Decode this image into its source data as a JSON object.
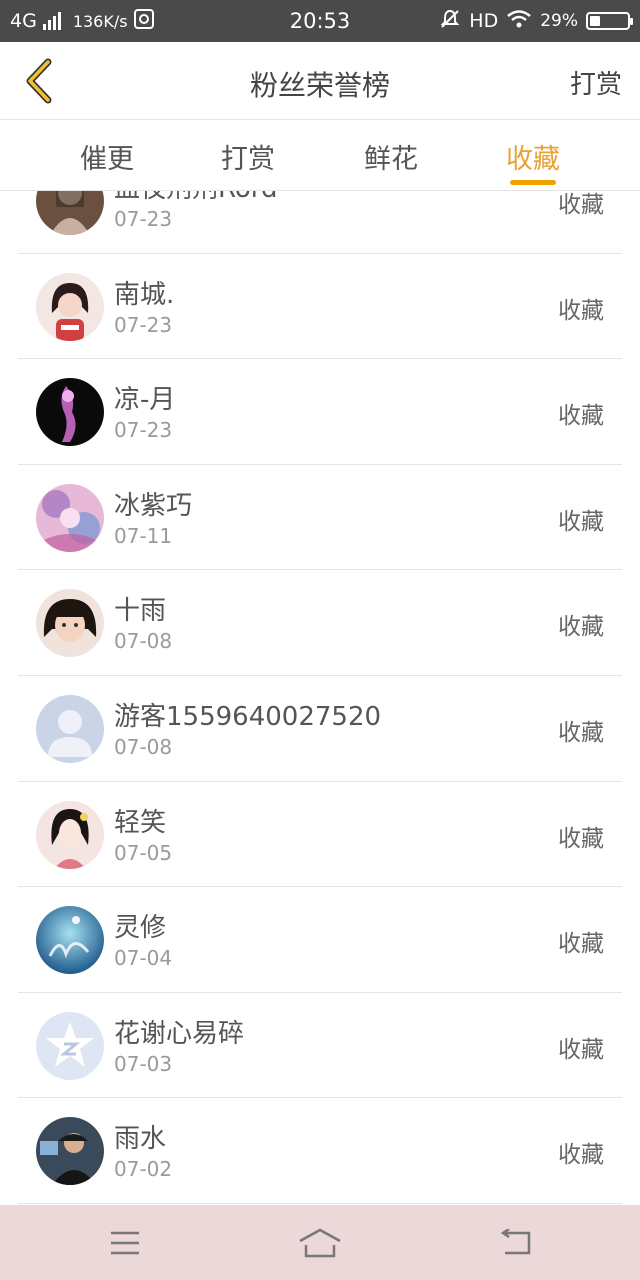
{
  "status_bar": {
    "network": "4G",
    "speed": "136K/s",
    "time": "20:53",
    "hd": "HD",
    "battery": "29%",
    "battery_level": 0.29,
    "icons": [
      "signal-icon",
      "nfc-icon",
      "mute-icon",
      "wifi-icon",
      "battery-icon"
    ]
  },
  "header": {
    "title": "粉丝荣誉榜",
    "action": "打赏",
    "back_icon": "chevron-left-icon"
  },
  "tabs": [
    {
      "label": "催更",
      "active": false
    },
    {
      "label": "打赏",
      "active": false
    },
    {
      "label": "鲜花",
      "active": false
    },
    {
      "label": "收藏",
      "active": true
    }
  ],
  "colors": {
    "accent": "#f0a300",
    "accent_text": "#e8a235",
    "status_bar": "#4a4a4a",
    "nav_bar": "#ecd7d9"
  },
  "fans": [
    {
      "name": "血夜剂剂Rord",
      "date": "07-23",
      "action": "收藏",
      "avatar": "brown-figure"
    },
    {
      "name": "南城.",
      "date": "07-23",
      "action": "收藏",
      "avatar": "girl-photo"
    },
    {
      "name": "凉-月",
      "date": "07-23",
      "action": "收藏",
      "avatar": "dark-pink-art"
    },
    {
      "name": "冰紫巧",
      "date": "07-11",
      "action": "收藏",
      "avatar": "anime-art"
    },
    {
      "name": "十雨",
      "date": "07-08",
      "action": "收藏",
      "avatar": "child-photo"
    },
    {
      "name": "游客1559640027520",
      "date": "07-08",
      "action": "收藏",
      "avatar": "default-user"
    },
    {
      "name": "轻笑",
      "date": "07-05",
      "action": "收藏",
      "avatar": "illustration-girl"
    },
    {
      "name": "灵修",
      "date": "07-04",
      "action": "收藏",
      "avatar": "blue-calligraphy"
    },
    {
      "name": "花谢心易碎",
      "date": "07-03",
      "action": "收藏",
      "avatar": "qq-star"
    },
    {
      "name": "雨水",
      "date": "07-02",
      "action": "收藏",
      "avatar": "man-photo"
    }
  ],
  "bottom_nav": [
    {
      "icon": "menu-icon"
    },
    {
      "icon": "home-icon"
    },
    {
      "icon": "back-icon"
    }
  ]
}
